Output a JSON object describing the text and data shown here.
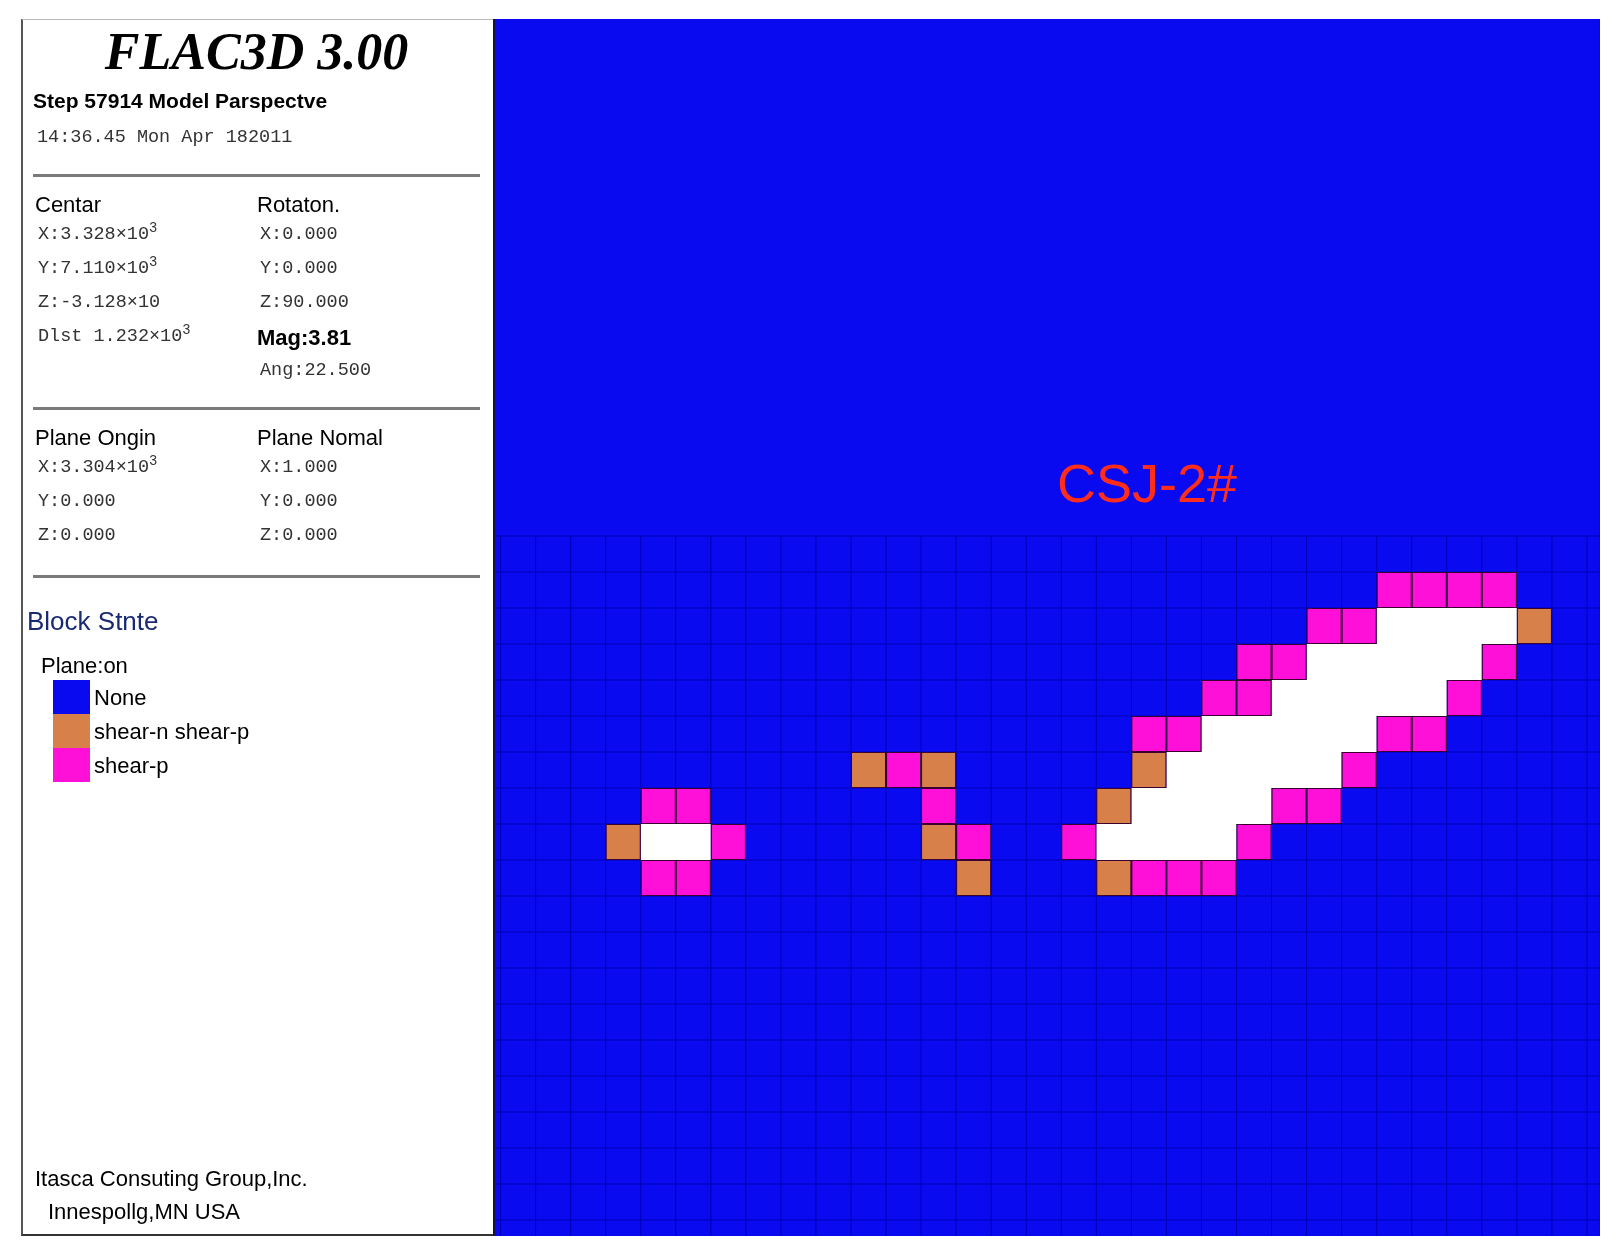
{
  "panel": {
    "title": "FLAC3D 3.00",
    "step": "Step 57914 Model Parspectve",
    "timestamp": "14:36.45 Mon Apr 182011",
    "sections": [
      {
        "columns": [
          {
            "lines": [
              {
                "kind": "heading",
                "text": "Centar"
              },
              {
                "kind": "value",
                "text": "X:3.328×10$^{3}$"
              },
              {
                "kind": "value",
                "text": "Y:7.110×10$^{3}$"
              },
              {
                "kind": "value",
                "text": "Z:-3.128×10"
              },
              {
                "kind": "value",
                "text": "Dlst 1.232×10$^{3}$"
              }
            ]
          },
          {
            "lines": [
              {
                "kind": "heading",
                "text": "Rotaton."
              },
              {
                "kind": "value",
                "text": "X:0.000"
              },
              {
                "kind": "value",
                "text": "Y:0.000"
              },
              {
                "kind": "value",
                "text": "Z:90.000"
              },
              {
                "kind": "strong",
                "text": "Mag:3.81"
              },
              {
                "kind": "value",
                "text": "Ang:22.500"
              }
            ]
          }
        ]
      },
      {
        "columns": [
          {
            "lines": [
              {
                "kind": "heading",
                "text": "Plane Ongin"
              },
              {
                "kind": "value",
                "text": "X:3.304×10$^{3}$"
              },
              {
                "kind": "value",
                "text": "Y:0.000"
              },
              {
                "kind": "value",
                "text": "Z:0.000"
              }
            ]
          },
          {
            "lines": [
              {
                "kind": "heading",
                "text": "Plane Nomal"
              },
              {
                "kind": "value",
                "text": "X:1.000"
              },
              {
                "kind": "value",
                "text": "Y:0.000"
              },
              {
                "kind": "value",
                "text": "Z:0.000"
              }
            ]
          }
        ]
      }
    ],
    "legend": {
      "title": "Block Stnte",
      "subtitle": "Plane:on",
      "items": [
        {
          "label": "None",
          "color": "#0a0af0"
        },
        {
          "label": "shear-n shear-p",
          "color": "#d8804a"
        },
        {
          "label": "shear-p",
          "color": "#ff10d8"
        }
      ]
    },
    "footer": [
      "Itasca Consuting Group,Inc.",
      "Innespollg,MN USA"
    ]
  },
  "model_view": {
    "label": "CSJ-2#"
  }
}
